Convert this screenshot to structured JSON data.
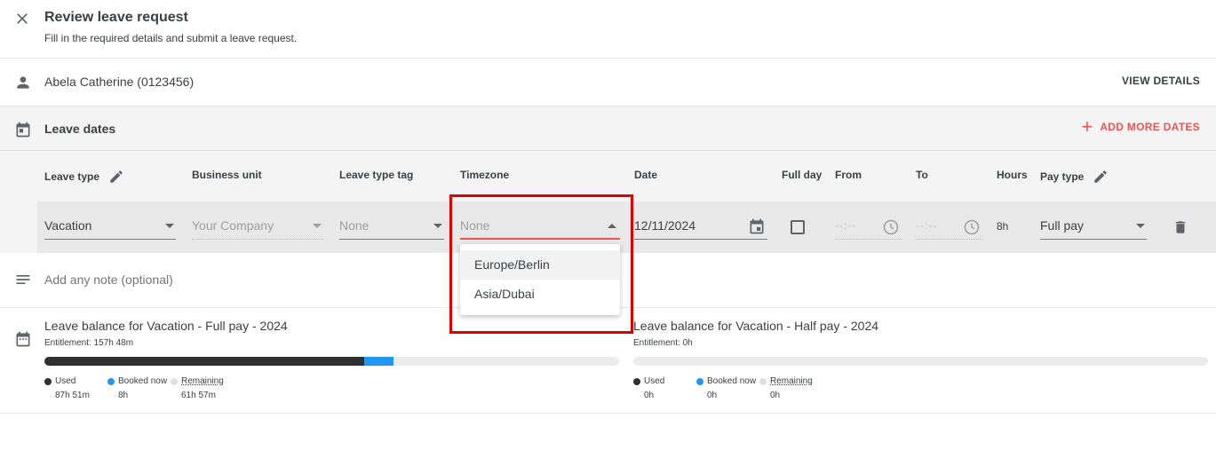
{
  "header": {
    "title": "Review leave request",
    "subtitle": "Fill in the required details and submit a leave request."
  },
  "employee": {
    "name": "Abela Catherine (0123456)",
    "view_details": "VIEW DETAILS"
  },
  "leave_dates": {
    "title": "Leave dates",
    "add_more": "ADD MORE DATES",
    "columns": {
      "leave_type": "Leave type",
      "business_unit": "Business unit",
      "leave_type_tag": "Leave type tag",
      "timezone": "Timezone",
      "date": "Date",
      "full_day": "Full day",
      "from": "From",
      "to": "To",
      "hours": "Hours",
      "pay_type": "Pay type"
    },
    "row": {
      "leave_type": "Vacation",
      "business_unit_placeholder": "Your Company",
      "leave_type_tag_placeholder": "None",
      "timezone_placeholder": "None",
      "date": "12/11/2024",
      "from_placeholder": "--:--",
      "to_placeholder": "--:--",
      "hours": "8h",
      "pay_type": "Full pay"
    }
  },
  "timezone_dropdown": {
    "options": [
      "Europe/Berlin",
      "Asia/Dubai"
    ]
  },
  "note": {
    "placeholder": "Add any note (optional)"
  },
  "balances": [
    {
      "title": "Leave balance for Vacation - Full pay - 2024",
      "entitlement": "Entitlement: 157h 48m",
      "used_label": "Used",
      "used_value": "87h 51m",
      "booked_label": "Booked now",
      "booked_value": "8h",
      "remaining_label": "Remaining",
      "remaining_value": "61h 57m",
      "used_fraction": 0.557,
      "booked_fraction": 0.051
    },
    {
      "title": "Leave balance for Vacation - Half pay - 2024",
      "entitlement": "Entitlement: 0h",
      "used_label": "Used",
      "used_value": "0h",
      "booked_label": "Booked now",
      "booked_value": "0h",
      "remaining_label": "Remaining",
      "remaining_value": "0h",
      "used_fraction": 0,
      "booked_fraction": 0
    }
  ],
  "colors": {
    "accent": "#ef5350",
    "used": "#303030",
    "booked": "#2196f3",
    "remaining": "#e0e0e0",
    "highlight": "#e00000"
  }
}
